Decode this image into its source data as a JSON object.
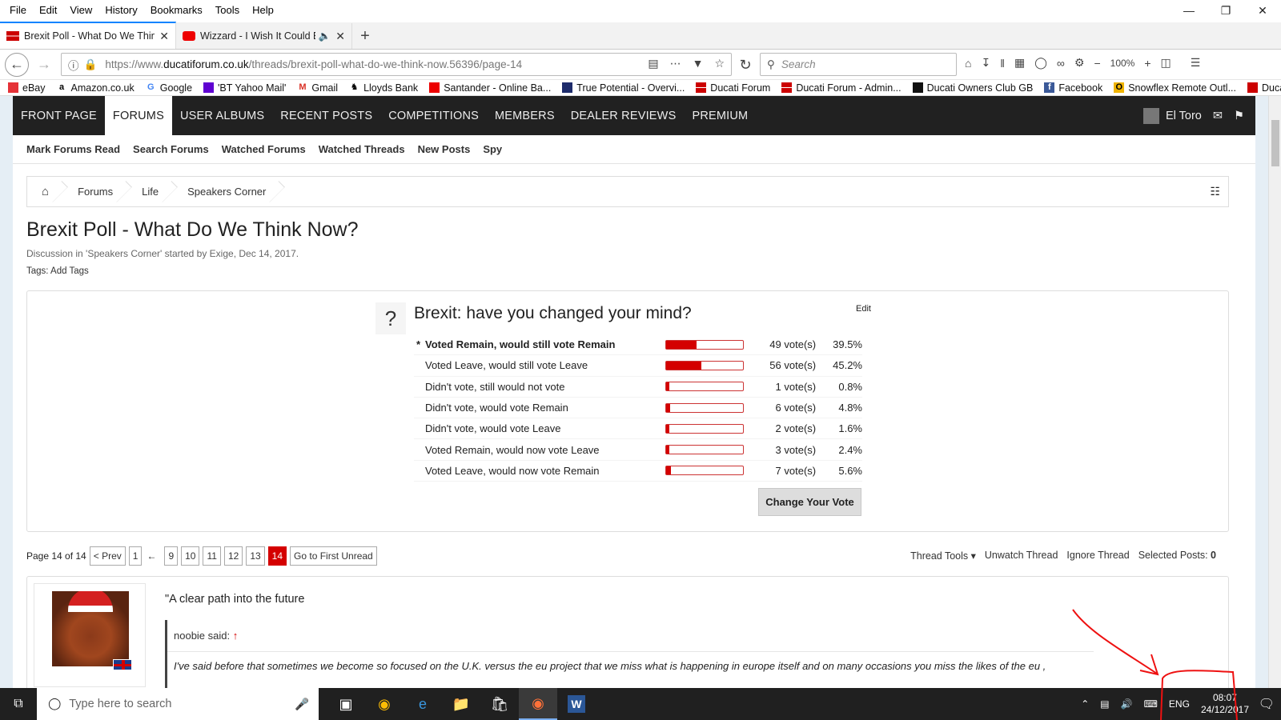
{
  "menu": [
    "File",
    "Edit",
    "View",
    "History",
    "Bookmarks",
    "Tools",
    "Help"
  ],
  "tabs": [
    {
      "title": "Brexit Poll - What Do We Think",
      "active": true
    },
    {
      "title": "Wizzard - I Wish It Could Be",
      "active": false
    }
  ],
  "url": {
    "prefix": "https://www.",
    "domain": "ducatiforum.co.uk",
    "path": "/threads/brexit-poll-what-do-we-think-now.56396/page-14"
  },
  "search_placeholder": "Search",
  "zoom": "100%",
  "bookmarks": [
    "eBay",
    "Amazon.co.uk",
    "Google",
    "'BT Yahoo Mail'",
    "Gmail",
    "Lloyds Bank",
    "Santander - Online Ba...",
    "True Potential - Overvi...",
    "Ducati Forum",
    "Ducati Forum - Admin...",
    "Ducati Owners Club GB",
    "Facebook",
    "Snowflex Remote Outl...",
    "Ducati"
  ],
  "site_nav": [
    "FRONT PAGE",
    "FORUMS",
    "USER ALBUMS",
    "RECENT POSTS",
    "COMPETITIONS",
    "MEMBERS",
    "DEALER REVIEWS",
    "PREMIUM"
  ],
  "user": "El Toro",
  "subnav": [
    "Mark Forums Read",
    "Search Forums",
    "Watched Forums",
    "Watched Threads",
    "New Posts",
    "Spy"
  ],
  "breadcrumb": [
    "Forums",
    "Life",
    "Speakers Corner"
  ],
  "thread": {
    "title": "Brexit Poll - What Do We Think Now?",
    "meta": "Discussion in 'Speakers Corner' started by Exige, Dec 14, 2017.",
    "tags": "Tags: Add Tags"
  },
  "poll": {
    "question": "Brexit: have you changed your mind?",
    "edit": "Edit",
    "change_vote": "Change Your Vote",
    "options": [
      {
        "label": "Voted Remain, would still vote Remain",
        "votes": "49 vote(s)",
        "pct": "39.5%",
        "fraction": 0.395,
        "voted": true
      },
      {
        "label": "Voted Leave, would still vote Leave",
        "votes": "56 vote(s)",
        "pct": "45.2%",
        "fraction": 0.452,
        "voted": false
      },
      {
        "label": "Didn't vote, still would not vote",
        "votes": "1 vote(s)",
        "pct": "0.8%",
        "fraction": 0.008,
        "voted": false
      },
      {
        "label": "Didn't vote, would vote Remain",
        "votes": "6 vote(s)",
        "pct": "4.8%",
        "fraction": 0.048,
        "voted": false
      },
      {
        "label": "Didn't vote, would vote Leave",
        "votes": "2 vote(s)",
        "pct": "1.6%",
        "fraction": 0.016,
        "voted": false
      },
      {
        "label": "Voted Remain, would now vote Leave",
        "votes": "3 vote(s)",
        "pct": "2.4%",
        "fraction": 0.024,
        "voted": false
      },
      {
        "label": "Voted Leave, would now vote Remain",
        "votes": "7 vote(s)",
        "pct": "5.6%",
        "fraction": 0.056,
        "voted": false
      }
    ]
  },
  "pager": {
    "label": "Page 14 of 14",
    "prev": "< Prev",
    "first": "1",
    "ellipsis": "←",
    "pages": [
      "9",
      "10",
      "11",
      "12",
      "13",
      "14"
    ],
    "current": "14",
    "first_unread": "Go to First Unread"
  },
  "thread_tools": {
    "tools": "Thread Tools ▾",
    "unwatch": "Unwatch Thread",
    "ignore": "Ignore Thread",
    "selected_label": "Selected Posts:",
    "selected_count": "0"
  },
  "post": {
    "text": "\"A clear path into the future",
    "quote_author": "noobie said:",
    "quote_arrow": "↑",
    "quote_text": "I've said before that sometimes we become so focused on the U.K. versus the eu project that we miss what is happening in europe itself and on many occasions you miss the likes of the eu ,"
  },
  "taskbar": {
    "search": "Type here to search",
    "lang": "ENG",
    "time": "08:07",
    "date": "24/12/2017"
  }
}
